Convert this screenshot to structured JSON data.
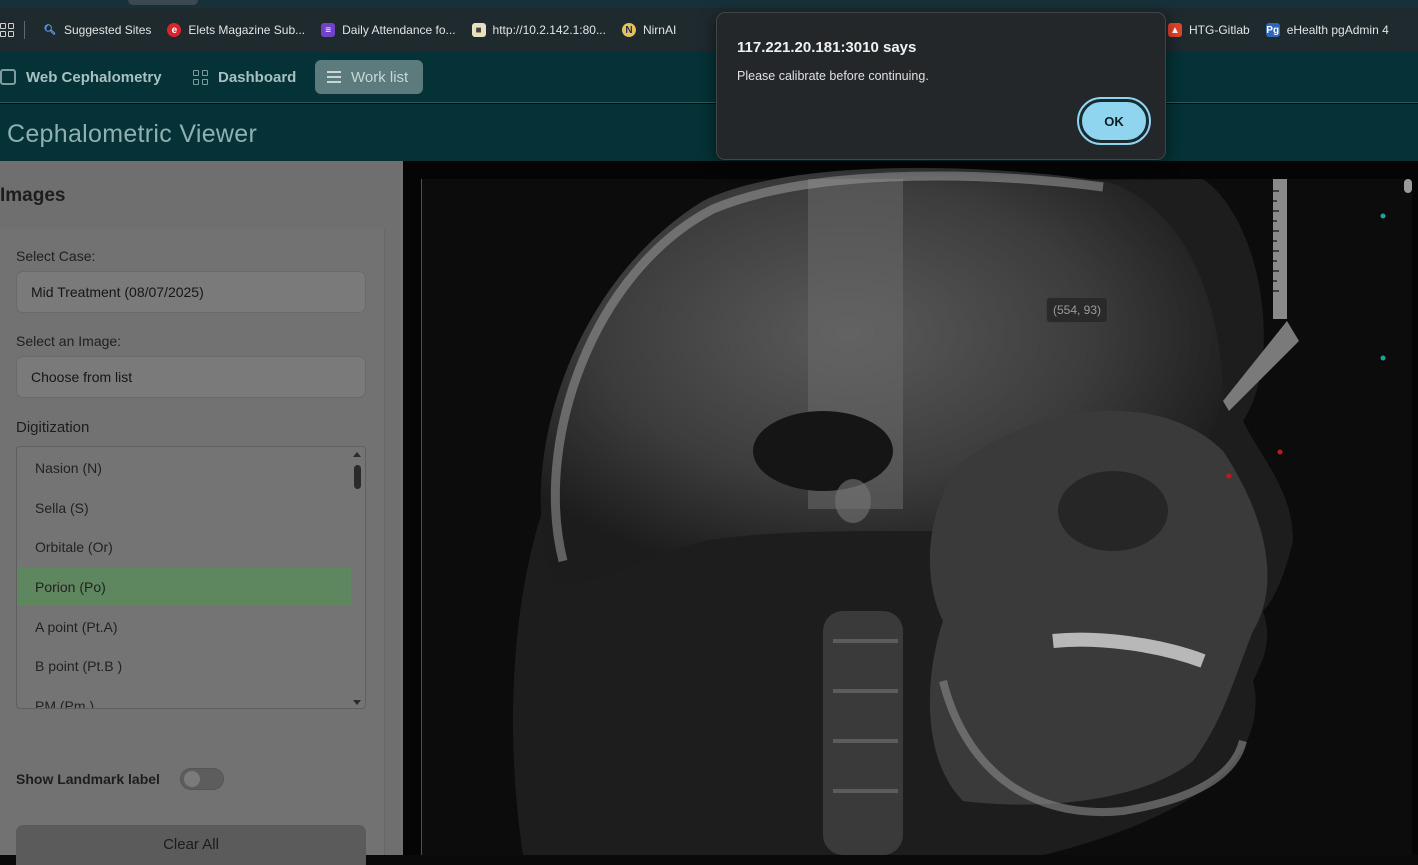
{
  "bookmarks": [
    {
      "label": "Suggested Sites",
      "icon": "search-icon"
    },
    {
      "label": "Elets Magazine Sub...",
      "icon": "elets-logo-icon"
    },
    {
      "label": "Daily Attendance fo...",
      "icon": "form-icon"
    },
    {
      "label": "http://10.2.142.1:80...",
      "icon": "page-icon"
    },
    {
      "label": "NirnAI",
      "icon": "nirnai-logo-icon"
    },
    {
      "label": "HTG-Gitlab",
      "icon": "gitlab-icon"
    },
    {
      "label": "eHealth pgAdmin 4",
      "icon": "pgadmin-icon"
    }
  ],
  "nav": {
    "brand": "Web Cephalometry",
    "dashboard": "Dashboard",
    "worklist": "Work list"
  },
  "page_title": "Cephalometric Viewer",
  "sidebar": {
    "title": "Images",
    "case_label": "Select Case:",
    "case_value": "Mid Treatment (08/07/2025)",
    "image_label": "Select an Image:",
    "image_value": "Choose from list",
    "digitization_title": "Digitization",
    "landmarks": [
      "Nasion (N)",
      "Sella (S)",
      "Orbitale (Or)",
      "Porion (Po)",
      "A point (Pt.A)",
      "B point (Pt.B )",
      "PM (Pm )"
    ],
    "selected_landmark": "Porion (Po)",
    "show_label_toggle": "Show Landmark label",
    "show_label_on": false,
    "clear_all": "Clear All"
  },
  "viewer": {
    "coordinate_readout": "(554, 93)"
  },
  "dialog": {
    "host": "117.221.20.181:3010 says",
    "message": "Please calibrate before continuing.",
    "ok_label": "OK"
  },
  "colors": {
    "header_bg": "#053236",
    "selected_row": "#5f875f",
    "ok_button": "#8fd5f0",
    "landmark_teal": "#1aa3a0",
    "landmark_red": "#c0191c"
  }
}
